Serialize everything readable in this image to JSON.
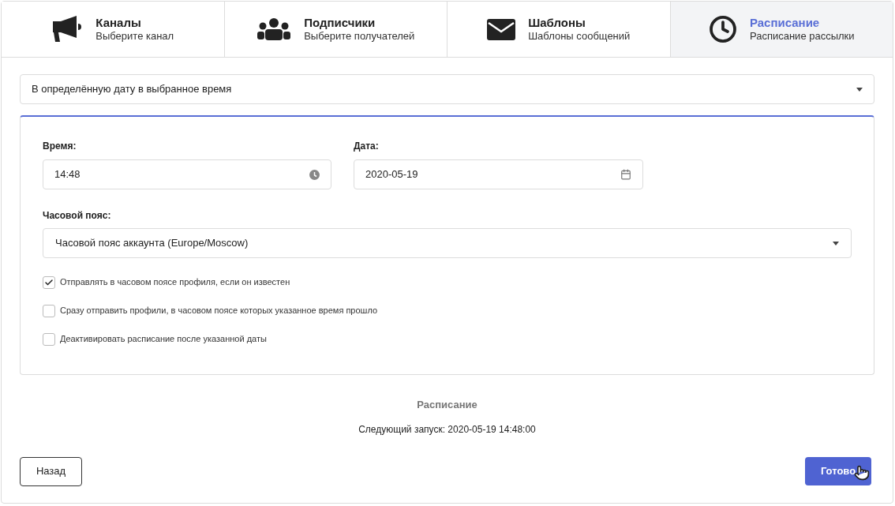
{
  "steps": [
    {
      "kind": "megaphone",
      "title": "Каналы",
      "subtitle": "Выберите канал",
      "selected": false
    },
    {
      "kind": "users",
      "title": "Подписчики",
      "subtitle": "Выберите получателей",
      "selected": false
    },
    {
      "kind": "envelope",
      "title": "Шаблоны",
      "subtitle": "Шаблоны сообщений",
      "selected": false
    },
    {
      "kind": "clock",
      "title": "Расписание",
      "subtitle": "Расписание рассылки",
      "selected": true
    }
  ],
  "schedule_type": {
    "value": "В определённую дату в выбранное время"
  },
  "time": {
    "label": "Время:",
    "value": "14:48"
  },
  "date": {
    "label": "Дата:",
    "value": "2020-05-19"
  },
  "timezone": {
    "label": "Часовой пояс:",
    "value": "Часовой пояс аккаунта (Europe/Moscow)"
  },
  "options": [
    {
      "label": "Отправлять в часовом поясе профиля, если он известен",
      "checked": true
    },
    {
      "label": "Сразу отправить профили, в часовом поясе которых указанное время прошло",
      "checked": false
    },
    {
      "label": "Деактивировать расписание после указанной даты",
      "checked": false
    }
  ],
  "summary": {
    "title": "Расписание",
    "next_run": "Следующий запуск: 2020-05-19 14:48:00"
  },
  "buttons": {
    "back": "Назад",
    "done": "Готово"
  }
}
